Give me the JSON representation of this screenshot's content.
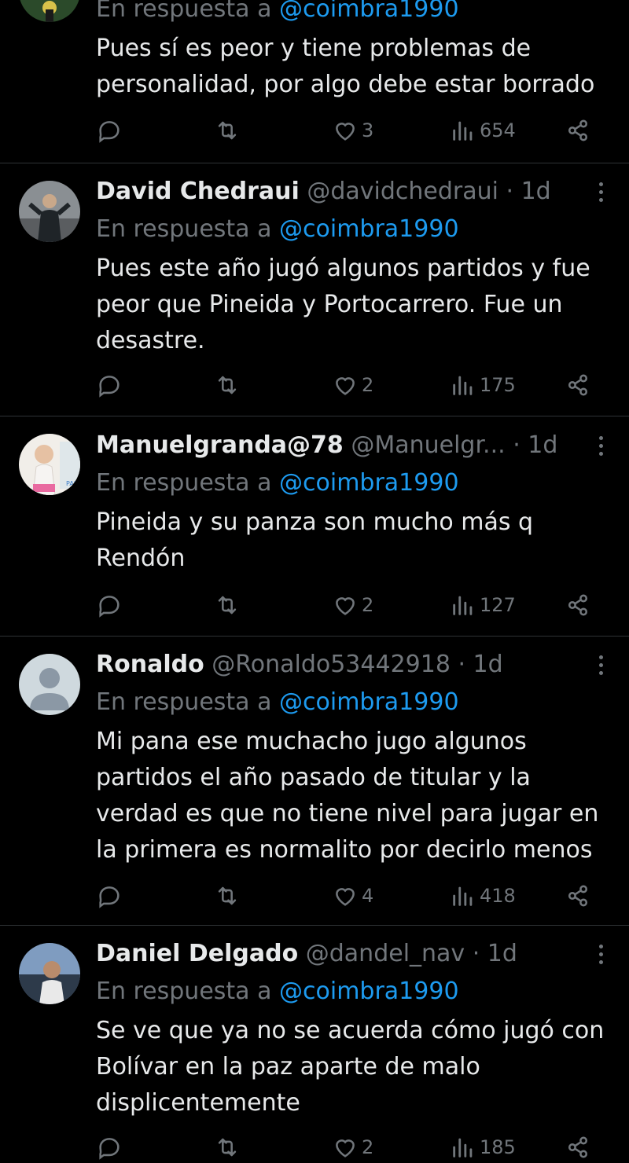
{
  "tweets": [
    {
      "reply_prefix": "En respuesta a ",
      "reply_handle": "@coimbra1990",
      "text": "Pues sí es peor y tiene problemas de personalidad, por algo debe estar borrado",
      "likes": "3",
      "views": "654"
    },
    {
      "display_name": "David Chedraui",
      "handle": "@davidchedraui",
      "dot": " · ",
      "time": "1d",
      "reply_prefix": "En respuesta a ",
      "reply_handle": "@coimbra1990",
      "text": "Pues este año jugó algunos partidos y fue peor que Pineida y Portocarrero. Fue un desastre.",
      "likes": "2",
      "views": "175"
    },
    {
      "display_name": "Manuelgranda@78",
      "handle": "@Manuelgr...",
      "dot": " · ",
      "time": "1d",
      "reply_prefix": "En respuesta a ",
      "reply_handle": "@coimbra1990",
      "text": "Pineida y su panza son mucho más q Rendón",
      "likes": "2",
      "views": "127"
    },
    {
      "display_name": "Ronaldo",
      "handle": "@Ronaldo53442918",
      "dot": " · ",
      "time": "1d",
      "reply_prefix": "En respuesta a ",
      "reply_handle": "@coimbra1990",
      "text": "Mi pana ese muchacho jugo algunos partidos el año pasado de titular y la verdad es que no tiene nivel para jugar en la primera es normalito por decirlo menos",
      "likes": "4",
      "views": "418"
    },
    {
      "display_name": "Daniel Delgado",
      "handle": "@dandel_nav",
      "dot": " · ",
      "time": "1d",
      "reply_prefix": "En respuesta a ",
      "reply_handle": "@coimbra1990",
      "text": "Se ve que ya no se acuerda cómo jugó con Bolívar en la paz aparte de malo displicentemente",
      "likes": "2",
      "views": "185"
    }
  ],
  "colors": {
    "background": "#000000",
    "text": "#e7e9ea",
    "muted": "#71767b",
    "accent": "#1d9bf0",
    "divider": "#2f3336"
  },
  "icons": [
    "reply-icon",
    "retweet-icon",
    "like-icon",
    "views-icon",
    "share-icon",
    "more-icon"
  ]
}
